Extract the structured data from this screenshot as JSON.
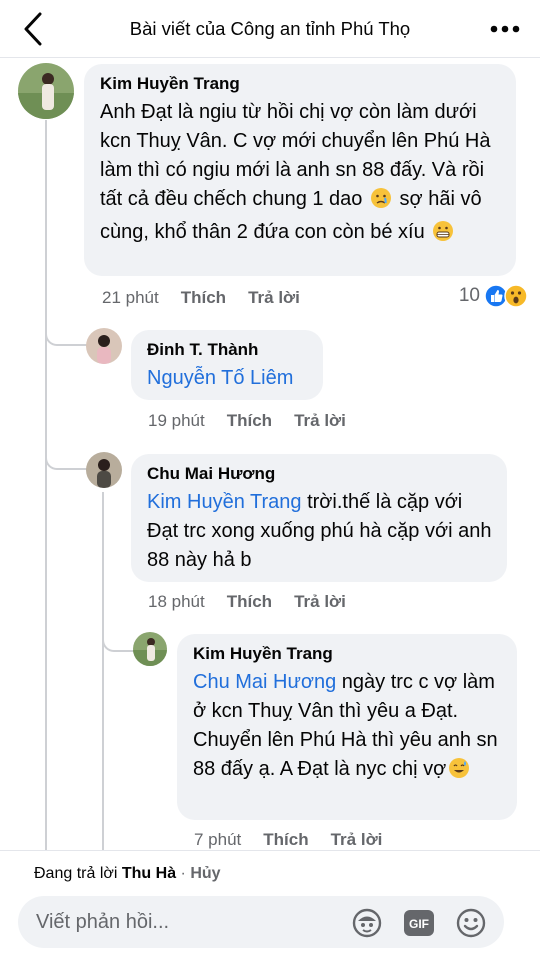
{
  "header": {
    "title": "Bài viết của Công an tỉnh Phú Thọ"
  },
  "comments": [
    {
      "author": "Kim Huyền Trang",
      "text_1": "Anh Đạt là ngiu từ hồi chị vợ còn làm dưới kcn Thuỵ Vân. C vợ mới chuyển lên Phú Hà làm thì có ngiu mới là anh sn 88 đấy. Và rồi tất cả đều chếch chung 1 dao",
      "text_2": "sợ hãi vô cùng, khổ thân 2 đứa con còn bé xíu",
      "time": "21 phút",
      "like": "Thích",
      "reply": "Trả lời",
      "reaction_count": "10"
    },
    {
      "author": "Đinh T. Thành",
      "mention": "Nguyễn Tố Liêm",
      "text": "",
      "time": "19 phút",
      "like": "Thích",
      "reply": "Trả lời"
    },
    {
      "author": "Chu Mai Hương",
      "mention": "Kim Huyền Trang",
      "text": " trời.thế là cặp với Đạt trc xong xuống phú hà cặp với anh 88 này hả b",
      "time": "18 phút",
      "like": "Thích",
      "reply": "Trả lời"
    },
    {
      "author": "Kim Huyền Trang",
      "mention": "Chu Mai Hương",
      "text": " ngày trc c vợ làm ở kcn Thuỵ Vân thì yêu a Đạt. Chuyển lên Phú Hà thì yêu anh sn 88 đấy ạ. A Đạt là nyc chị vợ",
      "time": "7 phút",
      "like": "Thích",
      "reply": "Trả lời"
    }
  ],
  "reply_bar": {
    "prefix": "Đang trả lời",
    "target": "Thu Hà",
    "separator": " · ",
    "cancel": "Hủy",
    "placeholder": "Viết phản hồi..."
  },
  "colors": {
    "link": "#216fdb",
    "bubble": "#f0f2f5",
    "meta": "#65676b",
    "like_blue": "#1877f2",
    "wow_yellow": "#f7b928"
  },
  "icons": [
    "back-chevron-icon",
    "more-dots-icon",
    "like-reaction-icon",
    "wow-reaction-icon",
    "crying-emoji-icon",
    "grimace-emoji-icon",
    "sweat-smile-emoji-icon",
    "avatar-sticker-icon",
    "gif-icon",
    "emoji-smiley-icon"
  ]
}
